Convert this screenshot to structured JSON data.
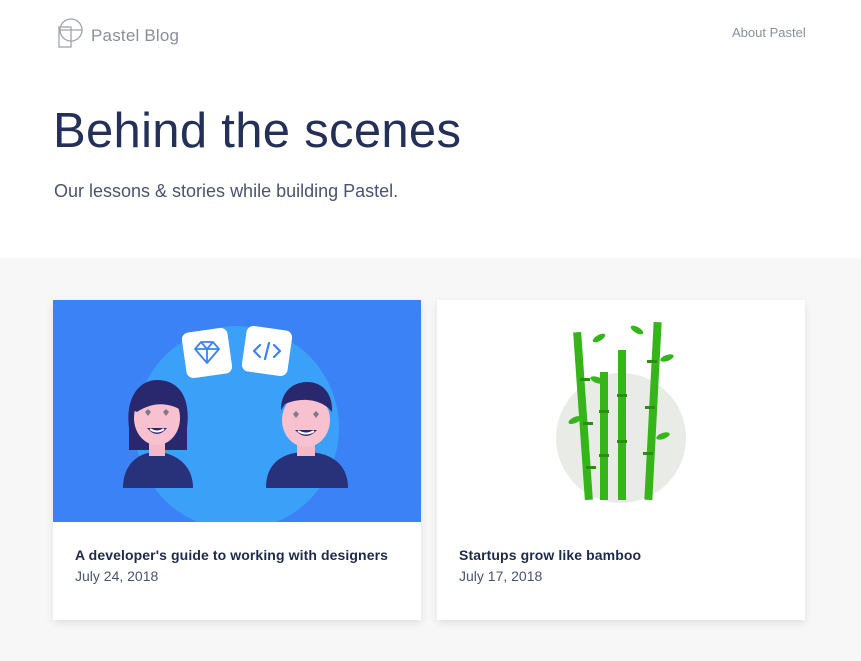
{
  "header": {
    "brand_name": "Pastel Blog",
    "nav_about": "About Pastel",
    "title": "Behind the scenes",
    "subtitle": "Our lessons & stories while building Pastel."
  },
  "posts": [
    {
      "title": "A developer's guide to working with designers",
      "date": "July 24, 2018",
      "image_icons": [
        "sketch-diamond-icon",
        "code-icon"
      ],
      "image_bg_color": "#3b82f6"
    },
    {
      "title": "Startups grow like bamboo",
      "date": "July 17, 2018",
      "image_bg_color": "#ffffff",
      "image_accent_color": "#35b51a"
    }
  ],
  "colors": {
    "title_text": "#243058",
    "muted_text": "#8a8f99",
    "section_bg": "#f6f7f6"
  }
}
